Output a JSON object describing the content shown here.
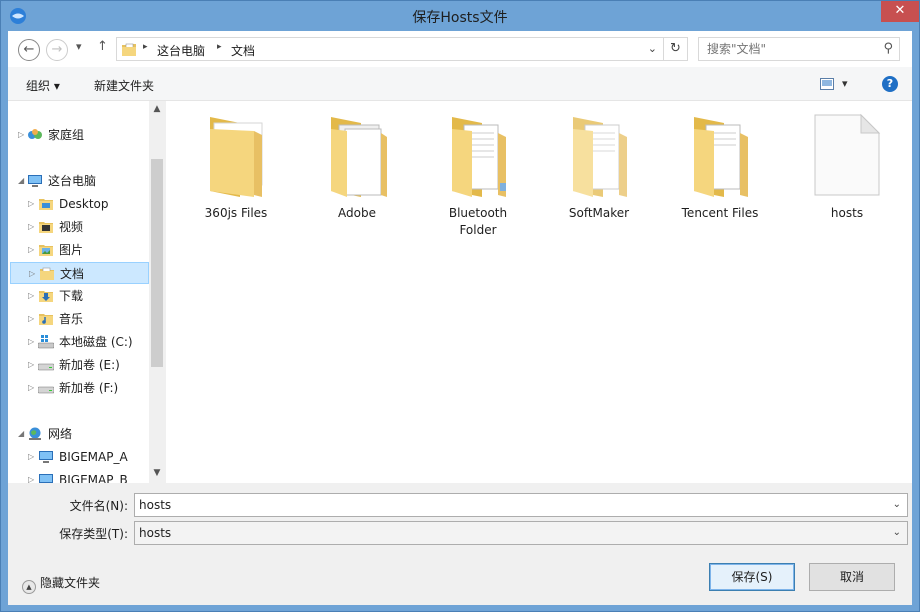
{
  "window": {
    "title": "保存Hosts文件",
    "close_glyph": "✕"
  },
  "nav": {
    "back_glyph": "←",
    "forward_glyph": "→",
    "recent_glyph": "▾",
    "up_glyph": "↑"
  },
  "address": {
    "segments": [
      "这台电脑",
      "文档"
    ],
    "separator": "▸",
    "dropdown_glyph": "⌄",
    "refresh_glyph": "↻"
  },
  "search": {
    "placeholder": "搜索\"文档\"",
    "icon_glyph": "⚲"
  },
  "toolbar": {
    "organize_label": "组织 ▾",
    "new_folder_label": "新建文件夹",
    "views_glyph": "▾",
    "help_glyph": "?"
  },
  "sidebar": {
    "items": [
      {
        "label": "家庭组",
        "icon": "homegroup-icon"
      },
      {
        "label": "这台电脑",
        "icon": "computer-icon"
      },
      {
        "label": "Desktop",
        "icon": "folder-icon"
      },
      {
        "label": "视频",
        "icon": "videos-folder-icon"
      },
      {
        "label": "图片",
        "icon": "pictures-folder-icon"
      },
      {
        "label": "文档",
        "icon": "documents-folder-icon",
        "selected": true
      },
      {
        "label": "下载",
        "icon": "downloads-folder-icon"
      },
      {
        "label": "音乐",
        "icon": "music-folder-icon"
      },
      {
        "label": "本地磁盘 (C:)",
        "icon": "system-drive-icon"
      },
      {
        "label": "新加卷 (E:)",
        "icon": "drive-icon"
      },
      {
        "label": "新加卷 (F:)",
        "icon": "drive-icon"
      },
      {
        "label": "网络",
        "icon": "network-icon"
      },
      {
        "label": "BIGEMAP_A",
        "icon": "network-computer-icon"
      },
      {
        "label": "BIGEMAP_B",
        "icon": "network-computer-icon"
      }
    ],
    "collapsed_arrow": "▷",
    "expanded_arrow": "◢",
    "scroll_up_glyph": "▲",
    "scroll_down_glyph": "▼"
  },
  "files": [
    {
      "name": "360js Files",
      "type": "folder"
    },
    {
      "name": "Adobe",
      "type": "folder"
    },
    {
      "name": "Bluetooth Folder",
      "type": "folder"
    },
    {
      "name": "SoftMaker",
      "type": "folder"
    },
    {
      "name": "Tencent Files",
      "type": "folder"
    },
    {
      "name": "hosts",
      "type": "file"
    }
  ],
  "form": {
    "filename_label": "文件名(N):",
    "filename_value": "hosts",
    "filetype_label": "保存类型(T):",
    "filetype_value": "hosts",
    "dropdown_glyph": "⌄",
    "hide_folders_label": "隐藏文件夹",
    "hide_folders_glyph": "▲",
    "save_label": "保存(S)",
    "cancel_label": "取消"
  },
  "colors": {
    "title_bar": "#6ea3d6",
    "close_button": "#c75050",
    "folder_yellow": "#f5d67e",
    "selection": "#cce8ff",
    "primary_button_border": "#3c7fb1"
  }
}
